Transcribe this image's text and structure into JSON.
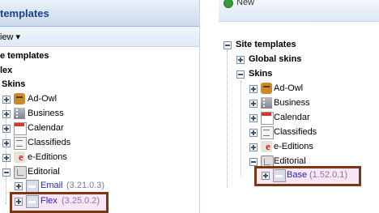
{
  "left": {
    "title": "templates",
    "toolbar_label": "iew ▾",
    "tree": {
      "root": "e templates",
      "flex": "lex",
      "skins": "Skins",
      "items": [
        "Ad-Owl",
        "Business",
        "Calendar",
        "Classifieds",
        "e-Editions",
        "Editorial"
      ],
      "email": {
        "name": "Email",
        "version": "(3.21.0.3)"
      },
      "flex_skin": {
        "name": "Flex",
        "version": "(3.25.0.2)"
      }
    }
  },
  "right": {
    "toolbar_label": "New",
    "tree": {
      "root": "Site templates",
      "global_skins": "Global skins",
      "skins": "Skins",
      "items": [
        "Ad-Owl",
        "Business",
        "Calendar",
        "Classifieds",
        "e-Editions",
        "Editorial"
      ],
      "base": {
        "name": "Base",
        "version": "(1.52.0.1)"
      }
    }
  },
  "colors": {
    "highlight_border": "#7b3613",
    "highlight_fill": "#fbe6f5",
    "link": "#2222cc"
  },
  "icons": [
    "owl-icon",
    "building-icon",
    "calendar-icon",
    "classifieds-icon",
    "e-editions-icon",
    "editorial-icon",
    "skin-icon"
  ]
}
